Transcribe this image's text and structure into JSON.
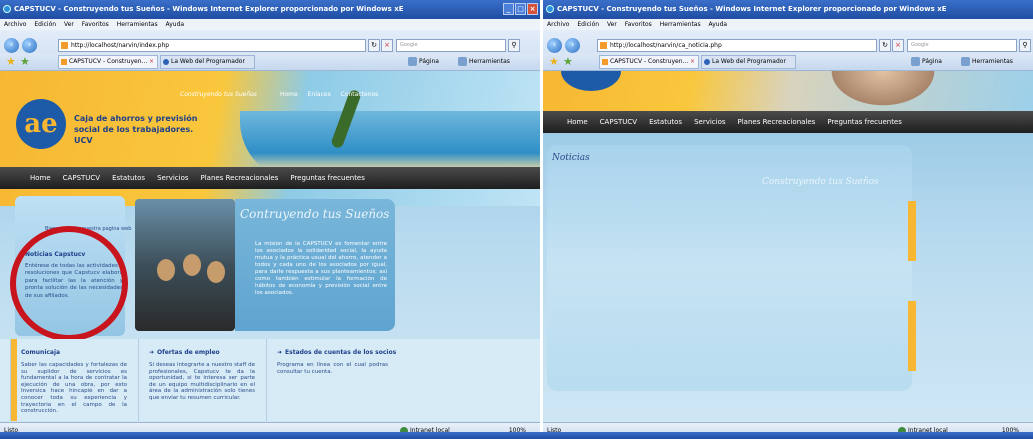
{
  "windows": [
    {
      "title": "CAPSTUCV - Construyendo tus Sueños - Windows Internet Explorer proporcionado por Windows xE",
      "menu": [
        "Archivo",
        "Edición",
        "Ver",
        "Favoritos",
        "Herramientas",
        "Ayuda"
      ],
      "url": "http://localhost/narvin/index.php",
      "search_placeholder": "Google",
      "tabs": [
        "CAPSTUCV - Construyen...",
        "La Web del Programador"
      ],
      "commands": [
        "Página",
        "Herramientas"
      ],
      "status": "Listo",
      "zone": "Intranet local",
      "zoom": "100%",
      "page": {
        "org_name": "Caja de ahorros y previsión social de los trabajadores. UCV",
        "top_slogan": "Construyendo tus Sueños",
        "top_nav": [
          "Home",
          "Enlaces",
          "Contactenos"
        ],
        "nav": [
          "Home",
          "CAPSTUCV",
          "Estatutos",
          "Servicios",
          "Planes Recreacionales",
          "Preguntas frecuentes"
        ],
        "welcome": "Bienvenidos a nuestra pagina web",
        "news_title": "Noticias Capstucv",
        "news_text": "Entérese de todas las actividades y resoluciones que Capstucv elabora para facilitar las la atención y pronta solución de las necesidades de sus afiliados.",
        "slogan": "Contruyendo tus Sueños",
        "mission": "La mision de la CAPSTUCV es fomentar entre los asociados la solidaridad social, la ayuda mutua y la práctica usual del ahorro, atender a todos y cada uno de los asociados por igual, para darle respuesta a sus planteamientos; así como también estimular la formación de hábitos de economía y previsión social entre los asociados.",
        "columns": [
          {
            "title": "Comunicaja",
            "text": "Saber las capacidades y fortalezas de su suplidor de servicios es fundamental a la hora de contratar la ejecución de una obra, por esto Inversica hace hincapié en dar a conocer toda su experiencia y trayectoria en el campo de la construcción."
          },
          {
            "title": "Ofertas de empleo",
            "text": "Si deseas integrarte a nuestro staff de profesionales, Capstucv te da la oportunidad, si te interesa ser parte de un equipo multidisciplinario en el área de la administración solo tienes que enviar tu resumen curricular."
          },
          {
            "title": "Estados de cuentas de los socios",
            "text": "Programa en línea con el cual podras consultar tu cuenta."
          }
        ]
      }
    },
    {
      "title": "CAPSTUCV - Construyendo tus Sueños - Windows Internet Explorer proporcionado por Windows xE",
      "menu": [
        "Archivo",
        "Edición",
        "Ver",
        "Favoritos",
        "Herramientas",
        "Ayuda"
      ],
      "url": "http://localhost/narvin/ca_noticia.php",
      "search_placeholder": "Google",
      "tabs": [
        "CAPSTUCV - Construyen...",
        "La Web del Programador"
      ],
      "commands": [
        "Página",
        "Herramientas"
      ],
      "status": "Listo",
      "zone": "Intranet local",
      "zoom": "100%",
      "page": {
        "nav": [
          "Home",
          "CAPSTUCV",
          "Estatutos",
          "Servicios",
          "Planes Recreacionales",
          "Preguntas frecuentes"
        ],
        "heading": "Noticias",
        "slogan": "Construyendo tus Sueños"
      }
    }
  ]
}
